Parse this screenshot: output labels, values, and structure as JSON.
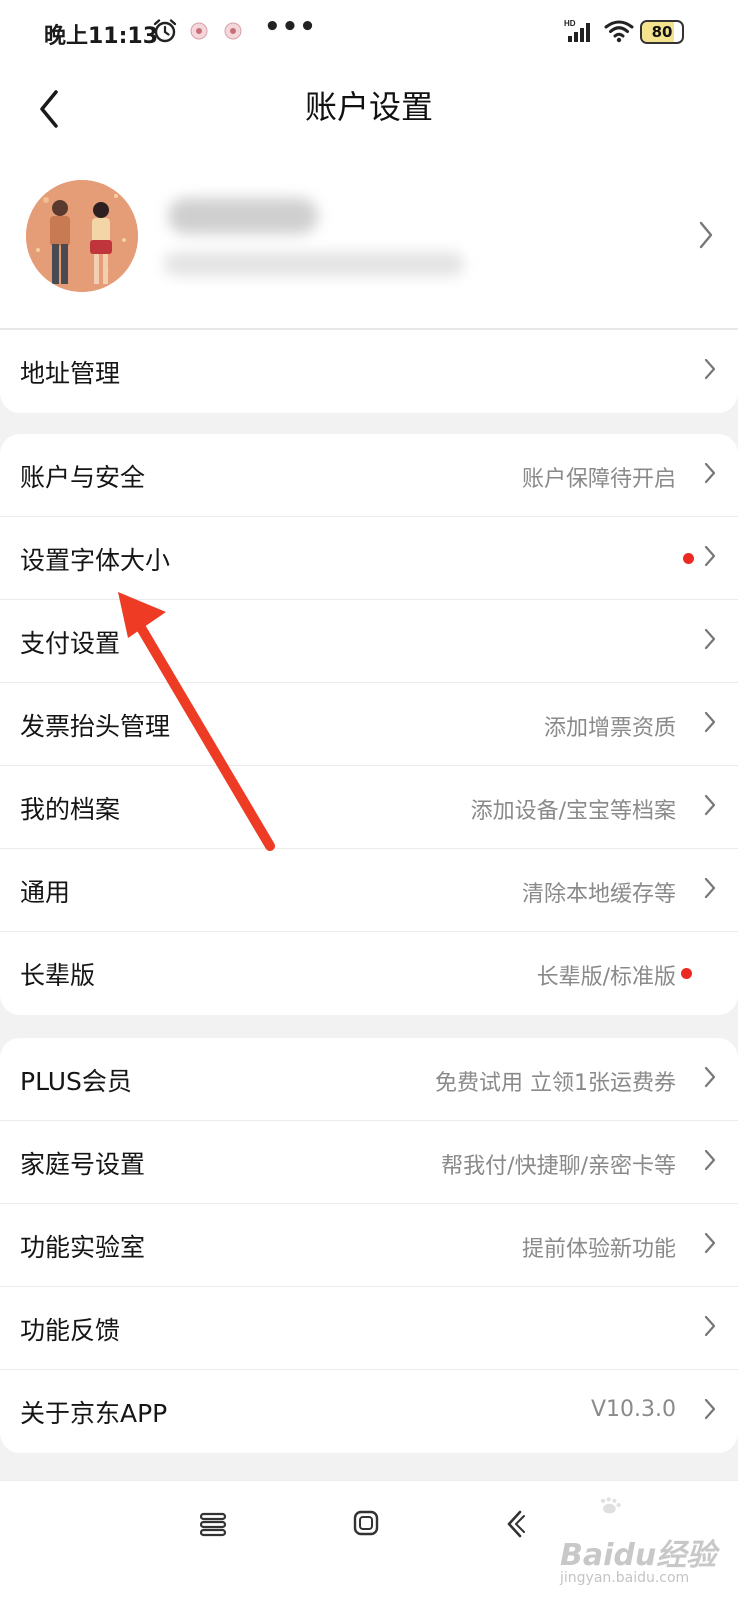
{
  "status_bar": {
    "time": "晚上11:13",
    "more": "•••",
    "network_badge": "HD",
    "battery_level": "80",
    "battery_fraction": 0.8
  },
  "header": {
    "title": "账户设置"
  },
  "address_row": {
    "label": "地址管理"
  },
  "group1": [
    {
      "label": "账户与安全",
      "value": "账户保障待开启"
    },
    {
      "label": "设置字体大小",
      "value": ""
    },
    {
      "label": "支付设置",
      "value": ""
    },
    {
      "label": "发票抬头管理",
      "value": "添加增票资质"
    },
    {
      "label": "我的档案",
      "value": "添加设备/宝宝等档案"
    },
    {
      "label": "通用",
      "value": "清除本地缓存等"
    },
    {
      "label": "长辈版",
      "value": "长辈版/标准版"
    }
  ],
  "group2": [
    {
      "label": "PLUS会员",
      "value": "免费试用 立领1张运费券"
    },
    {
      "label": "家庭号设置",
      "value": "帮我付/快捷聊/亲密卡等"
    },
    {
      "label": "功能实验室",
      "value": "提前体验新功能"
    },
    {
      "label": "功能反馈",
      "value": ""
    },
    {
      "label": "关于京东APP",
      "value": "V10.3.0"
    }
  ],
  "watermark": {
    "brand": "Baidu经验",
    "url": "jingyan.baidu.com"
  },
  "colors": {
    "red_dot": "#ec2a22",
    "annotation_arrow": "#ee3b24",
    "value_text": "#8a8a8a",
    "background": "#f2f2f2"
  },
  "icons": {
    "back": "chevron-left-icon",
    "row_arrow": "chevron-right-icon",
    "alarm": "alarm-clock-icon",
    "wifi": "wifi-icon",
    "signal": "cell-signal-icon",
    "nav_menu": "menu-icon",
    "nav_home": "home-icon",
    "nav_back": "back-icon"
  }
}
